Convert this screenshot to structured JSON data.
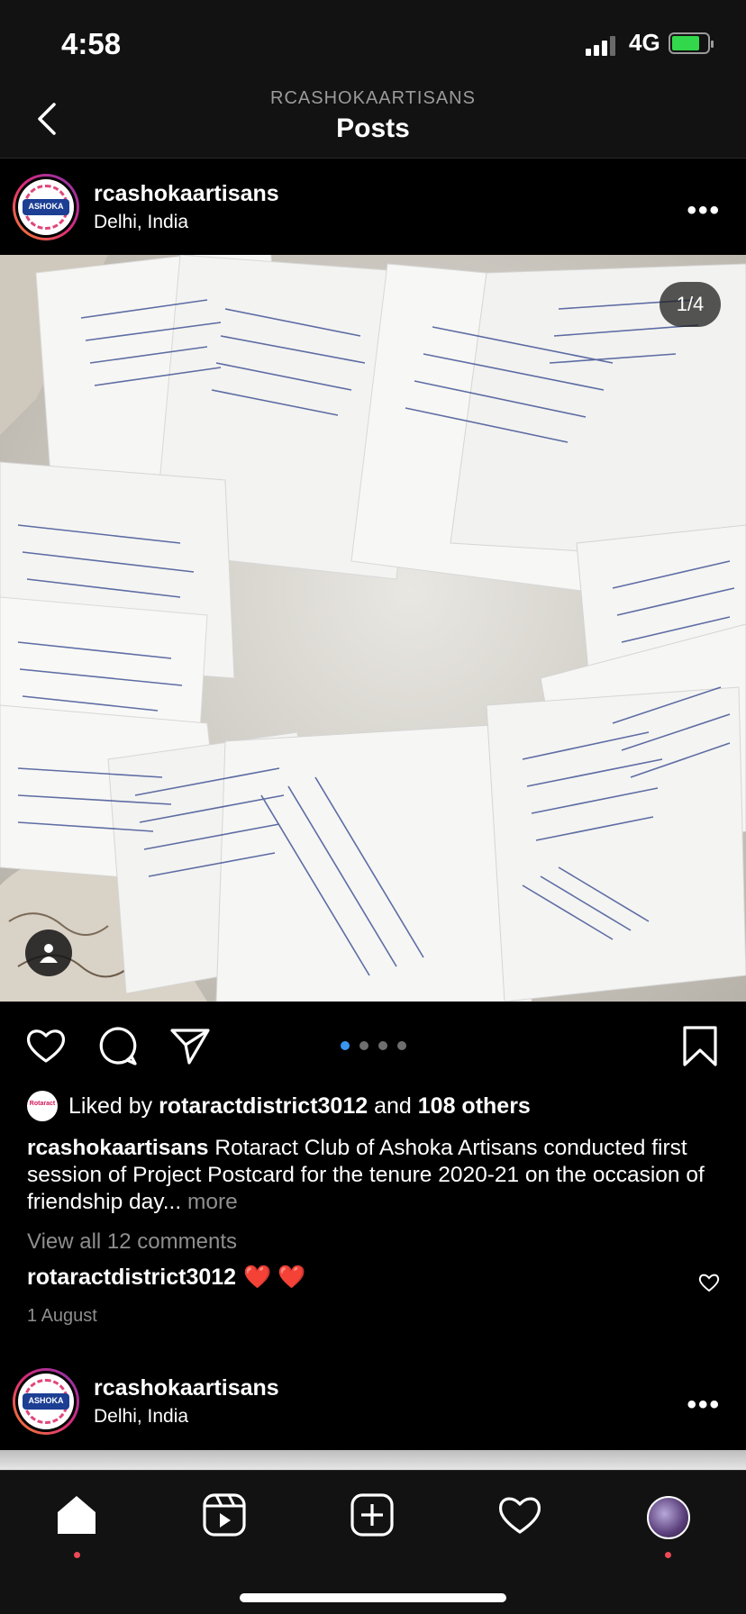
{
  "status_bar": {
    "time": "4:58",
    "network": "4G"
  },
  "nav": {
    "account": "RCASHOKAARTISANS",
    "title": "Posts"
  },
  "post": {
    "username": "rcashokaartisans",
    "location": "Delhi, India",
    "avatar_text": "ASHOKA",
    "image_counter": "1/4",
    "carousel": {
      "total": 4,
      "active": 1
    },
    "likes": {
      "prefix": "Liked by",
      "user": "rotaractdistrict3012",
      "middle": "and",
      "others": "108 others",
      "mini_text": "Rotaract"
    },
    "caption": {
      "username": "rcashokaartisans",
      "text": "Rotaract Club of Ashoka Artisans conducted first session of Project Postcard for the tenure 2020-21 on the occasion of friendship day...",
      "more": "more"
    },
    "view_comments": "View all 12 comments",
    "comment": {
      "user": "rotaractdistrict3012",
      "text": "❤️ ❤️"
    },
    "date": "1 August"
  },
  "postcards": [
    {
      "lines": [
        "From,",
        "Ojasvi",
        "56 G, K pocket",
        "Sekh Sarai, Phase 2",
        "New Delhi - 110017",
        "Ph No - 9643966118"
      ]
    },
    {
      "lines": [
        "To, Rahul",
        "H.No 10 puja Enclave colony",
        "Jam Bhumi Link Road",
        "Krishna Nagar, Mathura",
        "281001"
      ]
    },
    {
      "lines": [
        "To, Anuj",
        "T-1/19 first floor",
        "Upper Ground floor",
        "Kalkaji Extn, Delhi",
        "110019"
      ]
    },
    {
      "lines": [
        "To, Anjali",
        "First Floor, Renu Bhawan",
        "Vivekanand Colony",
        "Sundhwa, Renukoot"
      ]
    },
    {
      "lines": [
        "To, Pawan",
        "C/o Haridwar Prasad",
        "Ashok Nagar, Beside",
        "Amul High House",
        "835001"
      ]
    },
    {
      "lines": [
        "To, Sakshi",
        "Chhattisgarh Gopal Niwas Road",
        "Near Akash Murthi, Dhanbad",
        "Jharkhand - 826001"
      ]
    },
    {
      "lines": [
        "To, Abhishek",
        "Pandit Niwas Colony",
        "Near Bhayan ka Talab",
        "Chakor, Allahabad"
      ]
    },
    {
      "lines": [
        "Colony Murari",
        "Renukoot, 231217",
        "Ph No - 8826397141"
      ]
    },
    {
      "lines": [
        "To, Tripti",
        "Narayan",
        "C-6"
      ]
    },
    {
      "lines": [
        "To, Anjali",
        "House No. 3, Manas",
        "Garden Ayodhya",
        "Near Bank of",
        "Uttar Pradesh"
      ]
    }
  ],
  "colors": {
    "background": "#000000",
    "header_bg": "#121212",
    "muted": "#8e8e8e",
    "accent": "#3897f0",
    "notification": "#ed4956",
    "heart": "#e0245e"
  },
  "icons": {
    "back": "chevron-left-icon",
    "more": "more-horizontal-icon",
    "like": "heart-icon",
    "comment": "comment-bubble-icon",
    "share": "paper-plane-icon",
    "save": "bookmark-icon",
    "tag": "person-tag-icon",
    "tabs": [
      "home-icon",
      "reels-icon",
      "create-icon",
      "activity-heart-icon",
      "profile-avatar"
    ]
  }
}
